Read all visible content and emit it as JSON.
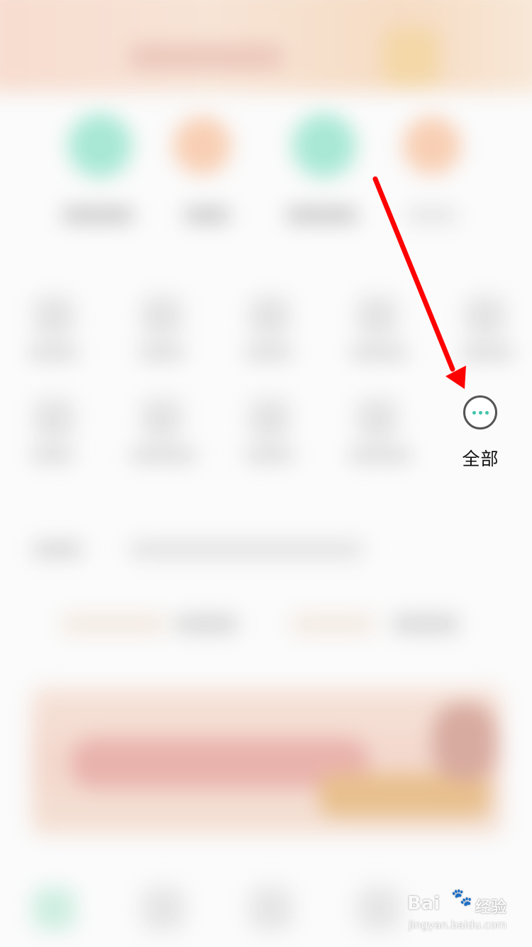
{
  "more_menu": {
    "icon": "more-dots-icon",
    "label": "全部"
  },
  "annotation": {
    "arrow_color": "#ff0000"
  },
  "watermark": {
    "brand": "Bai",
    "paw_icon": "paw-icon",
    "service": "经验",
    "url": "jingyan.baidu.com"
  },
  "colors": {
    "accent_green": "#3ec6a8",
    "icon_green": "#a8e8d4",
    "icon_orange": "#f8cfb4"
  }
}
